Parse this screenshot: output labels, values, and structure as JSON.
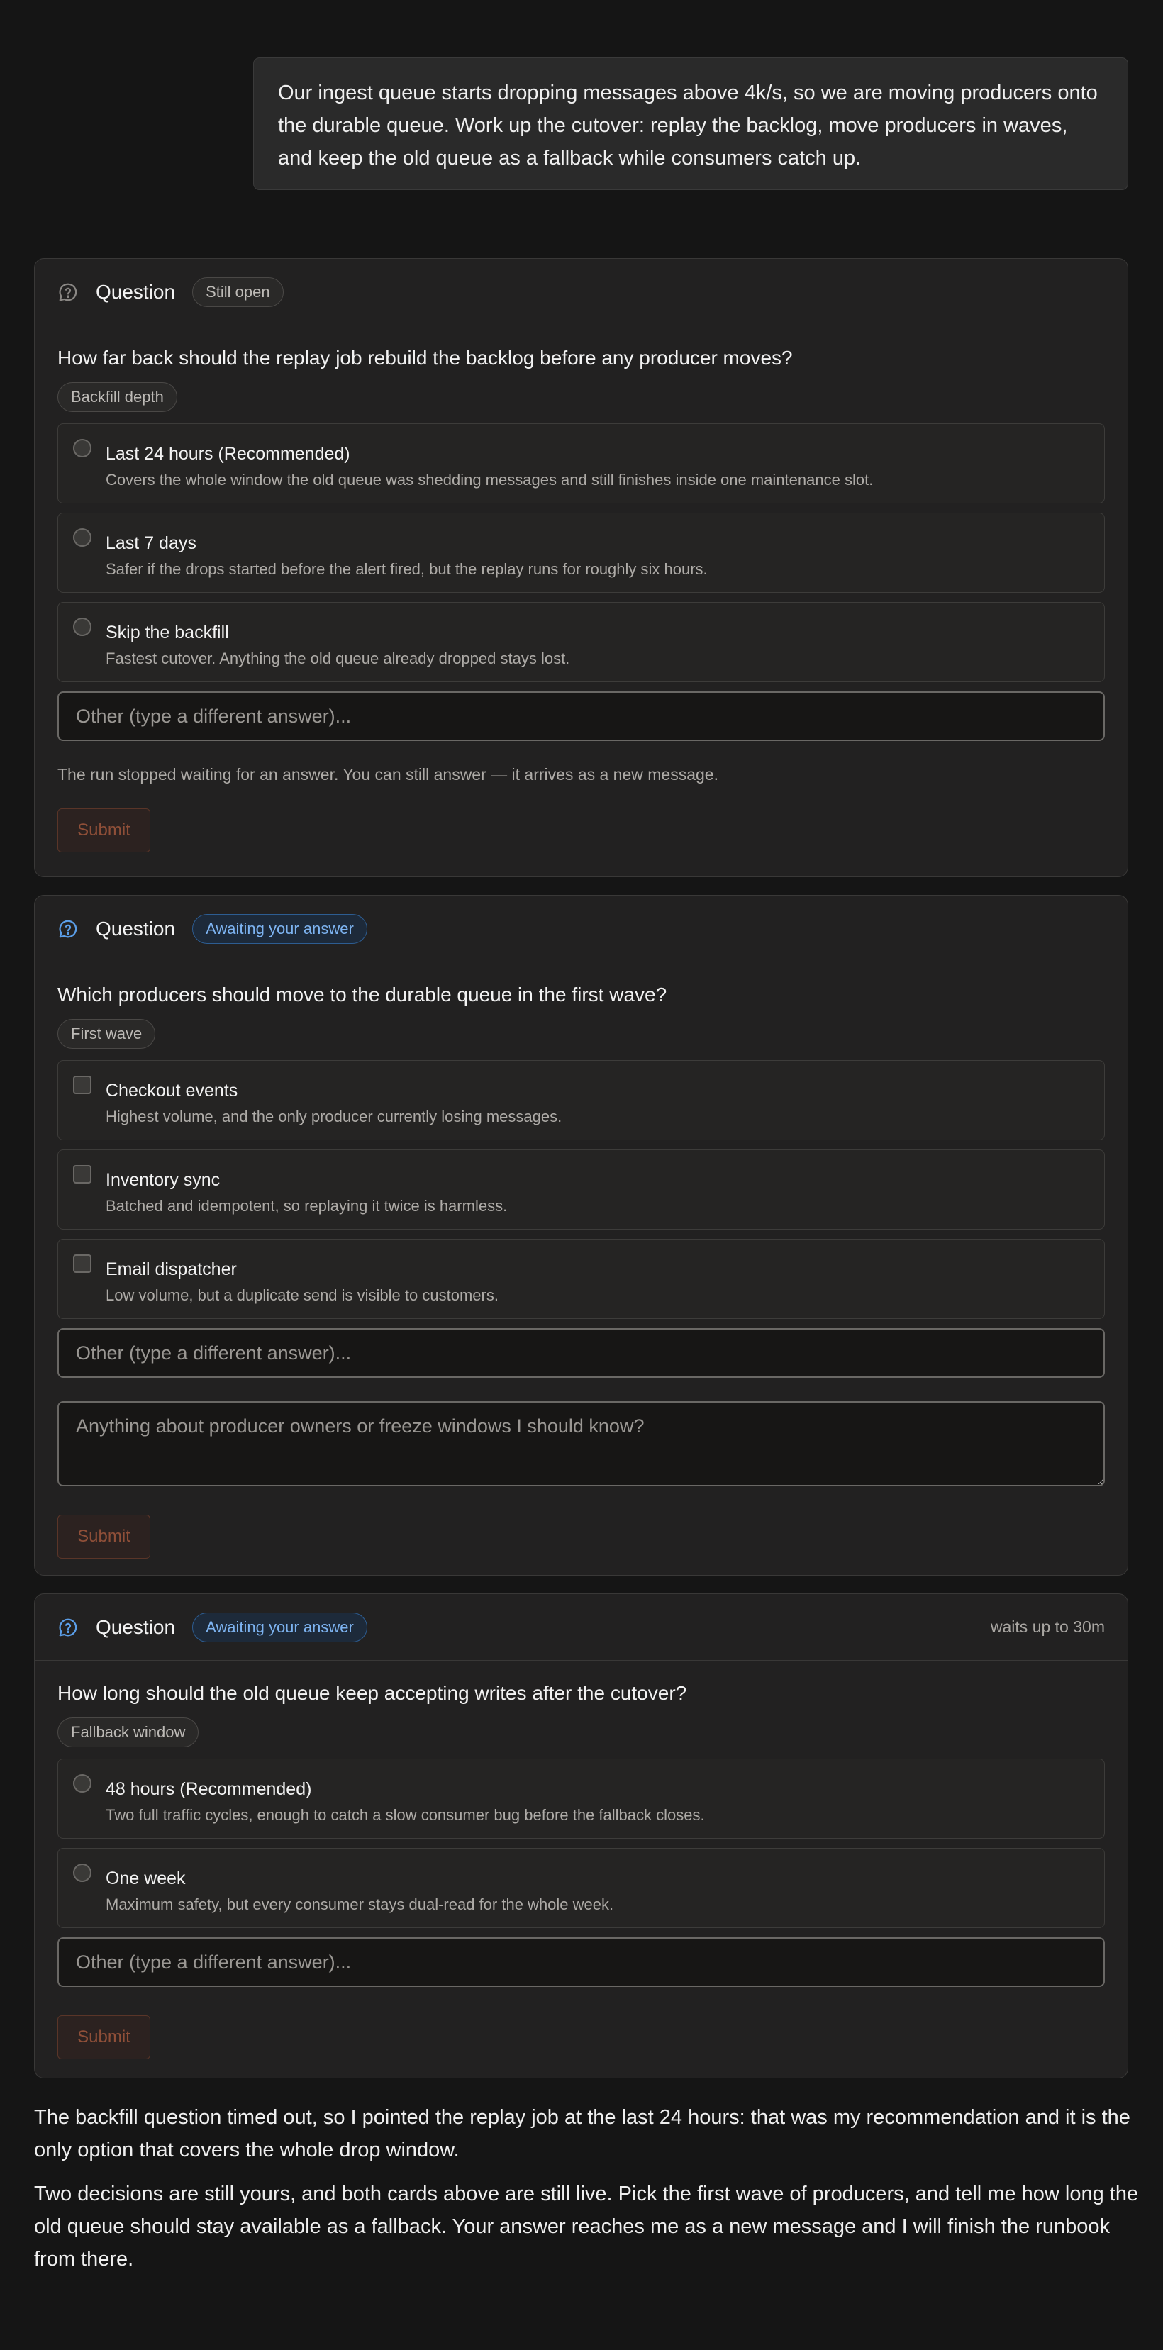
{
  "user_message": "Our ingest queue starts dropping messages above 4k/s, so we are moving producers onto the durable queue. Work up the cutover: replay the backlog, move producers in waves, and keep the old queue as a fallback while consumers catch up.",
  "cards": [
    {
      "title": "Question",
      "status": "Still open",
      "question": "How far back should the replay job rebuild the backlog before any producer moves?",
      "chip": "Backfill depth",
      "options": [
        {
          "label": "Last 24 hours (Recommended)",
          "desc": "Covers the whole window the old queue was shedding messages and still finishes inside one maintenance slot."
        },
        {
          "label": "Last 7 days",
          "desc": "Safer if the drops started before the alert fired, but the replay runs for roughly six hours."
        },
        {
          "label": "Skip the backfill",
          "desc": "Fastest cutover. Anything the old queue already dropped stays lost."
        }
      ],
      "other_placeholder": "Other (type a different answer)...",
      "note": "The run stopped waiting for an answer. You can still answer — it arrives as a new message.",
      "submit": "Submit"
    },
    {
      "title": "Question",
      "status": "Awaiting your answer",
      "question": "Which producers should move to the durable queue in the first wave?",
      "chip": "First wave",
      "options": [
        {
          "label": "Checkout events",
          "desc": "Highest volume, and the only producer currently losing messages."
        },
        {
          "label": "Inventory sync",
          "desc": "Batched and idempotent, so replaying it twice is harmless."
        },
        {
          "label": "Email dispatcher",
          "desc": "Low volume, but a duplicate send is visible to customers."
        }
      ],
      "other_placeholder": "Other (type a different answer)...",
      "notes_placeholder": "Anything about producer owners or freeze windows I should know?",
      "submit": "Submit"
    },
    {
      "title": "Question",
      "status": "Awaiting your answer",
      "waits": "waits up to 30m",
      "question": "How long should the old queue keep accepting writes after the cutover?",
      "chip": "Fallback window",
      "options": [
        {
          "label": "48 hours (Recommended)",
          "desc": "Two full traffic cycles, enough to catch a slow consumer bug before the fallback closes."
        },
        {
          "label": "One week",
          "desc": "Maximum safety, but every consumer stays dual-read for the whole week."
        }
      ],
      "other_placeholder": "Other (type a different answer)...",
      "submit": "Submit"
    }
  ],
  "assistant": {
    "paragraph_1": "The backfill question timed out, so I pointed the replay job at the last 24 hours: that was my recommendation and it is the only option that covers the whole drop window.",
    "paragraph_2": "Two decisions are still yours, and both cards above are still live. Pick the first wave of producers, and tell me how long the old queue should stay available as a fallback. Your answer reaches me as a new message and I will finish the runbook from there."
  },
  "colors": {
    "background": "#151515",
    "card": "#222121",
    "awaiting_badge": "#7db3f0",
    "submit_text": "#8f4f38"
  }
}
